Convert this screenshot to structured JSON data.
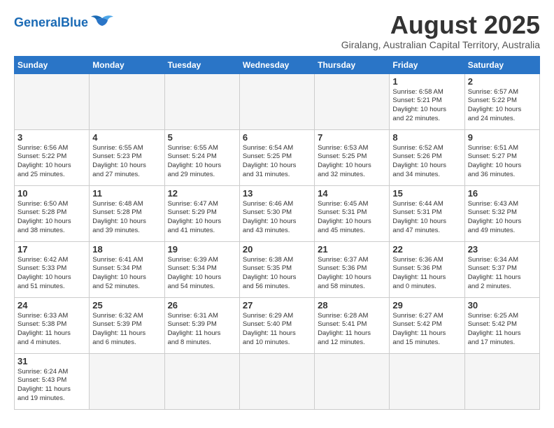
{
  "header": {
    "logo_general": "General",
    "logo_blue": "Blue",
    "month_title": "August 2025",
    "location": "Giralang, Australian Capital Territory, Australia"
  },
  "weekdays": [
    "Sunday",
    "Monday",
    "Tuesday",
    "Wednesday",
    "Thursday",
    "Friday",
    "Saturday"
  ],
  "weeks": [
    [
      {
        "day": "",
        "info": ""
      },
      {
        "day": "",
        "info": ""
      },
      {
        "day": "",
        "info": ""
      },
      {
        "day": "",
        "info": ""
      },
      {
        "day": "",
        "info": ""
      },
      {
        "day": "1",
        "info": "Sunrise: 6:58 AM\nSunset: 5:21 PM\nDaylight: 10 hours\nand 22 minutes."
      },
      {
        "day": "2",
        "info": "Sunrise: 6:57 AM\nSunset: 5:22 PM\nDaylight: 10 hours\nand 24 minutes."
      }
    ],
    [
      {
        "day": "3",
        "info": "Sunrise: 6:56 AM\nSunset: 5:22 PM\nDaylight: 10 hours\nand 25 minutes."
      },
      {
        "day": "4",
        "info": "Sunrise: 6:55 AM\nSunset: 5:23 PM\nDaylight: 10 hours\nand 27 minutes."
      },
      {
        "day": "5",
        "info": "Sunrise: 6:55 AM\nSunset: 5:24 PM\nDaylight: 10 hours\nand 29 minutes."
      },
      {
        "day": "6",
        "info": "Sunrise: 6:54 AM\nSunset: 5:25 PM\nDaylight: 10 hours\nand 31 minutes."
      },
      {
        "day": "7",
        "info": "Sunrise: 6:53 AM\nSunset: 5:25 PM\nDaylight: 10 hours\nand 32 minutes."
      },
      {
        "day": "8",
        "info": "Sunrise: 6:52 AM\nSunset: 5:26 PM\nDaylight: 10 hours\nand 34 minutes."
      },
      {
        "day": "9",
        "info": "Sunrise: 6:51 AM\nSunset: 5:27 PM\nDaylight: 10 hours\nand 36 minutes."
      }
    ],
    [
      {
        "day": "10",
        "info": "Sunrise: 6:50 AM\nSunset: 5:28 PM\nDaylight: 10 hours\nand 38 minutes."
      },
      {
        "day": "11",
        "info": "Sunrise: 6:48 AM\nSunset: 5:28 PM\nDaylight: 10 hours\nand 39 minutes."
      },
      {
        "day": "12",
        "info": "Sunrise: 6:47 AM\nSunset: 5:29 PM\nDaylight: 10 hours\nand 41 minutes."
      },
      {
        "day": "13",
        "info": "Sunrise: 6:46 AM\nSunset: 5:30 PM\nDaylight: 10 hours\nand 43 minutes."
      },
      {
        "day": "14",
        "info": "Sunrise: 6:45 AM\nSunset: 5:31 PM\nDaylight: 10 hours\nand 45 minutes."
      },
      {
        "day": "15",
        "info": "Sunrise: 6:44 AM\nSunset: 5:31 PM\nDaylight: 10 hours\nand 47 minutes."
      },
      {
        "day": "16",
        "info": "Sunrise: 6:43 AM\nSunset: 5:32 PM\nDaylight: 10 hours\nand 49 minutes."
      }
    ],
    [
      {
        "day": "17",
        "info": "Sunrise: 6:42 AM\nSunset: 5:33 PM\nDaylight: 10 hours\nand 51 minutes."
      },
      {
        "day": "18",
        "info": "Sunrise: 6:41 AM\nSunset: 5:34 PM\nDaylight: 10 hours\nand 52 minutes."
      },
      {
        "day": "19",
        "info": "Sunrise: 6:39 AM\nSunset: 5:34 PM\nDaylight: 10 hours\nand 54 minutes."
      },
      {
        "day": "20",
        "info": "Sunrise: 6:38 AM\nSunset: 5:35 PM\nDaylight: 10 hours\nand 56 minutes."
      },
      {
        "day": "21",
        "info": "Sunrise: 6:37 AM\nSunset: 5:36 PM\nDaylight: 10 hours\nand 58 minutes."
      },
      {
        "day": "22",
        "info": "Sunrise: 6:36 AM\nSunset: 5:36 PM\nDaylight: 11 hours\nand 0 minutes."
      },
      {
        "day": "23",
        "info": "Sunrise: 6:34 AM\nSunset: 5:37 PM\nDaylight: 11 hours\nand 2 minutes."
      }
    ],
    [
      {
        "day": "24",
        "info": "Sunrise: 6:33 AM\nSunset: 5:38 PM\nDaylight: 11 hours\nand 4 minutes."
      },
      {
        "day": "25",
        "info": "Sunrise: 6:32 AM\nSunset: 5:39 PM\nDaylight: 11 hours\nand 6 minutes."
      },
      {
        "day": "26",
        "info": "Sunrise: 6:31 AM\nSunset: 5:39 PM\nDaylight: 11 hours\nand 8 minutes."
      },
      {
        "day": "27",
        "info": "Sunrise: 6:29 AM\nSunset: 5:40 PM\nDaylight: 11 hours\nand 10 minutes."
      },
      {
        "day": "28",
        "info": "Sunrise: 6:28 AM\nSunset: 5:41 PM\nDaylight: 11 hours\nand 12 minutes."
      },
      {
        "day": "29",
        "info": "Sunrise: 6:27 AM\nSunset: 5:42 PM\nDaylight: 11 hours\nand 15 minutes."
      },
      {
        "day": "30",
        "info": "Sunrise: 6:25 AM\nSunset: 5:42 PM\nDaylight: 11 hours\nand 17 minutes."
      }
    ],
    [
      {
        "day": "31",
        "info": "Sunrise: 6:24 AM\nSunset: 5:43 PM\nDaylight: 11 hours\nand 19 minutes."
      },
      {
        "day": "",
        "info": ""
      },
      {
        "day": "",
        "info": ""
      },
      {
        "day": "",
        "info": ""
      },
      {
        "day": "",
        "info": ""
      },
      {
        "day": "",
        "info": ""
      },
      {
        "day": "",
        "info": ""
      }
    ]
  ]
}
